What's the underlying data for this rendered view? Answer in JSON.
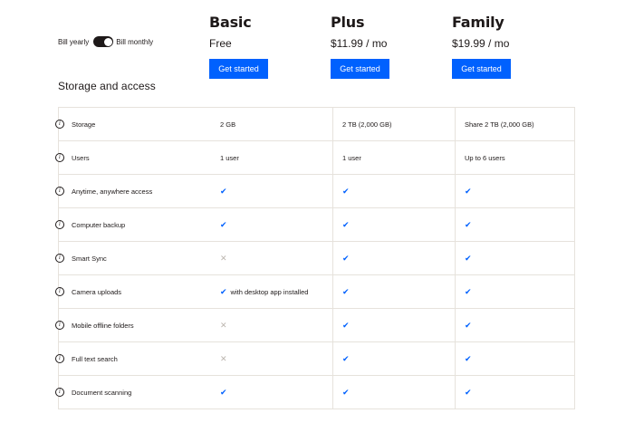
{
  "billing": {
    "yearly_label": "Bill yearly",
    "monthly_label": "Bill monthly",
    "toggle_state": "monthly"
  },
  "plans": [
    {
      "name": "Basic",
      "price": "Free",
      "cta": "Get started"
    },
    {
      "name": "Plus",
      "price": "$11.99 / mo",
      "cta": "Get started"
    },
    {
      "name": "Family",
      "price": "$19.99 / mo",
      "cta": "Get started"
    }
  ],
  "section_title": "Storage and access",
  "info_glyph": "i",
  "glyphs": {
    "check": "✔",
    "cross": "✕"
  },
  "colors": {
    "accent": "#0061fe",
    "text": "#1e1919",
    "border": "#e6e2dc",
    "cross": "#bbb5ae"
  },
  "features": [
    {
      "label": "Storage",
      "basic": "2 GB",
      "plus": "2 TB (2,000 GB)",
      "family": "Share 2 TB (2,000 GB)"
    },
    {
      "label": "Users",
      "basic": "1 user",
      "plus": "1 user",
      "family": "Up to 6 users"
    },
    {
      "label": "Anytime, anywhere access",
      "basic": "check",
      "plus": "check",
      "family": "check"
    },
    {
      "label": "Computer backup",
      "basic": "check",
      "plus": "check",
      "family": "check"
    },
    {
      "label": "Smart Sync",
      "basic": "cross",
      "plus": "check",
      "family": "check"
    },
    {
      "label": "Camera uploads",
      "basic": "check",
      "basic_note": "with desktop app installed",
      "plus": "check",
      "family": "check"
    },
    {
      "label": "Mobile offline folders",
      "basic": "cross",
      "plus": "check",
      "family": "check"
    },
    {
      "label": "Full text search",
      "basic": "cross",
      "plus": "check",
      "family": "check"
    },
    {
      "label": "Document scanning",
      "basic": "check",
      "plus": "check",
      "family": "check"
    }
  ]
}
